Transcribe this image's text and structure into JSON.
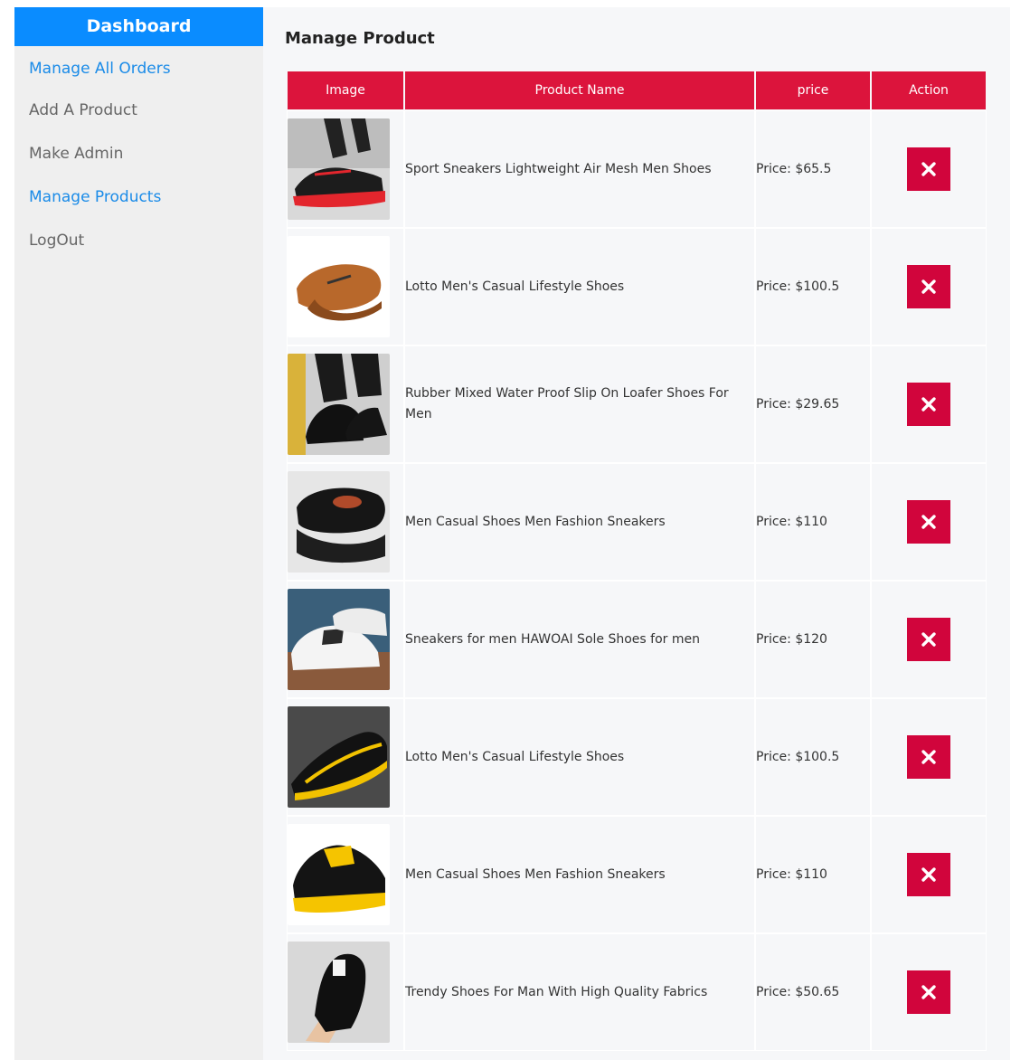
{
  "sidebar": {
    "title": "Dashboard",
    "items": [
      {
        "label": "Manage All Orders"
      },
      {
        "label": "Add A Product"
      },
      {
        "label": "Make Admin"
      },
      {
        "label": "Manage Products"
      },
      {
        "label": "LogOut"
      }
    ]
  },
  "main": {
    "title": "Manage Product",
    "table": {
      "headers": [
        "Image",
        "Product Name",
        "price",
        "Action"
      ],
      "rows": [
        {
          "name": "Sport Sneakers Lightweight Air Mesh Men Shoes",
          "price": "Price: $65.5"
        },
        {
          "name": "Lotto Men's Casual Lifestyle Shoes",
          "price": "Price: $100.5"
        },
        {
          "name": "Rubber Mixed Water Proof Slip On Loafer Shoes For Men",
          "price": "Price: $29.65"
        },
        {
          "name": "Men Casual Shoes Men Fashion Sneakers",
          "price": "Price: $110"
        },
        {
          "name": "Sneakers for men HAWOAI Sole Shoes for men",
          "price": "Price: $120"
        },
        {
          "name": "Lotto Men's Casual Lifestyle Shoes",
          "price": "Price: $100.5"
        },
        {
          "name": "Men Casual Shoes Men Fashion Sneakers",
          "price": "Price: $110"
        },
        {
          "name": "Trendy Shoes For Man With High Quality Fabrics",
          "price": "Price: $50.65"
        }
      ]
    }
  },
  "colors": {
    "accent_blue": "#0a8cff",
    "header_red": "#dc143c",
    "delete_red": "#d1053c"
  },
  "icons": {
    "delete": "close-icon",
    "product_image": "shoe-photo"
  }
}
